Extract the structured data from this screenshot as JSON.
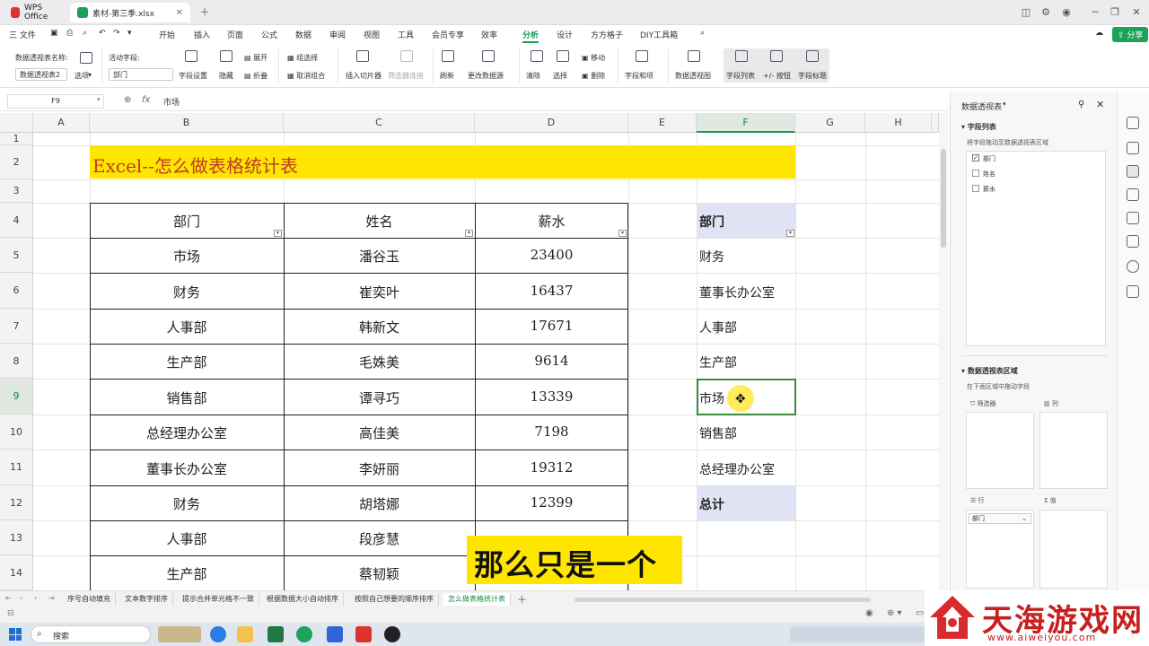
{
  "titlebar": {
    "app_tab": "WPS Office",
    "file_tab": "素材-第三季.xlsx"
  },
  "menu": {
    "file": "三 文件",
    "items": [
      "开始",
      "插入",
      "页面",
      "公式",
      "数据",
      "审阅",
      "视图",
      "工具",
      "会员专享",
      "效率",
      "分析",
      "设计",
      "方方格子",
      "DIY工具箱"
    ],
    "active": "分析",
    "share": "分享"
  },
  "ribbon": {
    "pivot_name_label": "数据透视表名称:",
    "pivot_name_value": "数据透视表2",
    "options": "选项",
    "active_field_label": "活动字段:",
    "active_field_value": "部门",
    "field_settings": "字段设置",
    "hide": "隐藏",
    "expand": "展开",
    "collapse": "折叠",
    "group_selection": "组选择",
    "ungroup": "取消组合",
    "insert_slicer": "插入切片器",
    "filter_connections": "筛选器连接",
    "refresh": "刷新",
    "change_source": "更改数据源",
    "clear": "清除",
    "select": "选择",
    "move": "移动",
    "delete": "删除",
    "fields_items": "字段和项",
    "pivot_chart": "数据透视图",
    "field_list": "字段列表",
    "plus_minus": "+/- 按钮",
    "field_headers": "字段标题"
  },
  "formula_bar": {
    "cell_ref": "F9",
    "content": "市场"
  },
  "columns": [
    "A",
    "B",
    "C",
    "D",
    "E",
    "F",
    "G",
    "H"
  ],
  "rows": [
    "1",
    "2",
    "3",
    "4",
    "5",
    "6",
    "7",
    "8",
    "9",
    "10",
    "11",
    "12",
    "13",
    "14"
  ],
  "sheet": {
    "title": "Excel--怎么做表格统计表",
    "headers": [
      "部门",
      "姓名",
      "薪水"
    ],
    "data": [
      [
        "市场",
        "潘谷玉",
        "23400"
      ],
      [
        "财务",
        "崔奕叶",
        "16437"
      ],
      [
        "人事部",
        "韩新文",
        "17671"
      ],
      [
        "生产部",
        "毛姝美",
        "9614"
      ],
      [
        "销售部",
        "谭寻巧",
        "13339"
      ],
      [
        "总经理办公室",
        "高佳美",
        "7198"
      ],
      [
        "董事长办公室",
        "李妍丽",
        "19312"
      ],
      [
        "财务",
        "胡塔娜",
        "12399"
      ],
      [
        "人事部",
        "段彦慧",
        ""
      ],
      [
        "生产部",
        "蔡韧颖",
        ""
      ]
    ]
  },
  "pivot": {
    "header": "部门",
    "items": [
      "财务",
      "董事长办公室",
      "人事部",
      "生产部",
      "市场",
      "销售部",
      "总经理办公室"
    ],
    "total": "总计"
  },
  "panel": {
    "title": "数据透视表",
    "field_list_title": "字段列表",
    "field_list_hint": "将字段拖动至数据透视表区域",
    "fields": [
      {
        "label": "部门",
        "checked": true
      },
      {
        "label": "姓名",
        "checked": false
      },
      {
        "label": "薪水",
        "checked": false
      }
    ],
    "areas_title": "数据透视表区域",
    "areas_hint": "在下面区域中拖动字段",
    "filter": "筛选器",
    "column": "列",
    "row": "行",
    "value": "值",
    "row_field": "部门"
  },
  "sheet_tabs": [
    "序号自动填充",
    "文本数字排序",
    "提示合并单元格不一致",
    "根据数据大小自动排序",
    "按照自己想要的顺序排序",
    "怎么做表格统计表"
  ],
  "active_sheet": "怎么做表格统计表",
  "taskbar": {
    "search": "搜索"
  },
  "subtitle": "那么只是一个",
  "watermark": {
    "name": "天海游戏网",
    "url": "www.aiweiyou.com"
  }
}
